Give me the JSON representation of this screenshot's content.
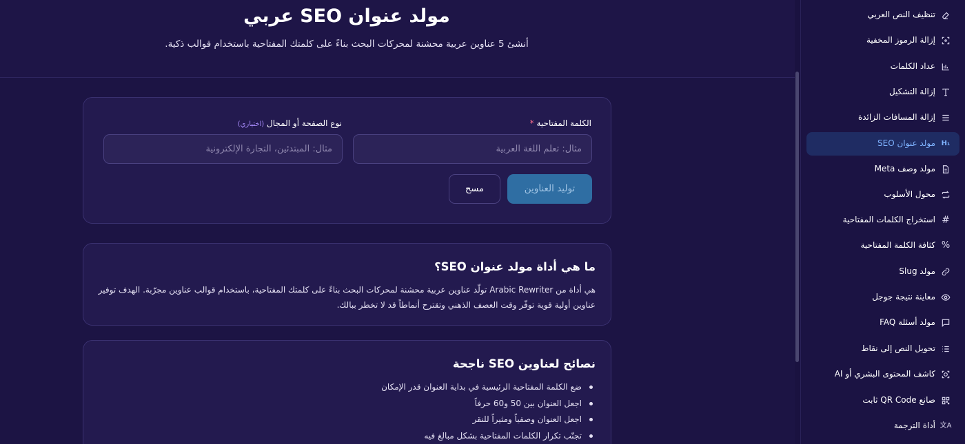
{
  "header": {
    "title": "مولد عنوان SEO عربي",
    "subtitle": "أنشئ 5 عناوين عربية محشنة لمحركات البحث بناءً على كلمتك المفتاحية باستخدام قوالب ذكية."
  },
  "form": {
    "keyword_label": "الكلمة المفتاحية",
    "keyword_required_mark": "*",
    "keyword_placeholder": "مثال: تعلم اللغة العربية",
    "type_label": "نوع الصفحة أو المجال",
    "type_optional": "(اختياري)",
    "type_placeholder": "مثال: المبتدئين، التجارة الإلكترونية",
    "generate_label": "توليد العناوين",
    "clear_label": "مسح"
  },
  "info": {
    "title": "ما هي أداة مولد عنوان SEO؟",
    "text": "هي أداة من Arabic Rewriter تولّد عناوين عربية محشنة لمحركات البحث بناءً على كلمتك المفتاحية، باستخدام قوالب عناوين مجرّبة. الهدف توفير عناوين أولية قوية توفّر وقت العصف الذهني وتقترح أنماطاً قد لا تخطر ببالك."
  },
  "tips": {
    "title": "نصائح لعناوين SEO ناجحة",
    "items": [
      "ضع الكلمة المفتاحية الرئيسية في بداية العنوان قدر الإمكان",
      "اجعل العنوان بين 50 و60 حرفاً",
      "اجعل العنوان وصفياً ومثيراً للنقر",
      "تجنّب تكرار الكلمات المفتاحية بشكل مبالغ فيه"
    ]
  },
  "sidebar": {
    "items": [
      {
        "label": "تنظيف النص العربي",
        "icon": "eraser-icon"
      },
      {
        "label": "إزالة الرموز المخفية",
        "icon": "scan-icon"
      },
      {
        "label": "عداد الكلمات",
        "icon": "chart-icon"
      },
      {
        "label": "إزالة التشكيل",
        "icon": "type-icon"
      },
      {
        "label": "إزالة المسافات الزائدة",
        "icon": "lines-icon"
      },
      {
        "label": "مولد عنوان SEO",
        "icon": "heading-icon",
        "glyph": "H₁",
        "active": true
      },
      {
        "label": "مولد وصف Meta",
        "icon": "file-icon"
      },
      {
        "label": "محول الأسلوب",
        "icon": "repeat-icon"
      },
      {
        "label": "استخراج الكلمات المفتاحية",
        "icon": "hash-icon",
        "glyph": "#"
      },
      {
        "label": "كثافة الكلمة المفتاحية",
        "icon": "percent-icon",
        "glyph": "%"
      },
      {
        "label": "مولد Slug",
        "icon": "link-icon"
      },
      {
        "label": "معاينة نتيجة جوجل",
        "icon": "eye-icon"
      },
      {
        "label": "مولد أسئلة FAQ",
        "icon": "message-icon"
      },
      {
        "label": "تحويل النص إلى نقاط",
        "icon": "list-icon"
      },
      {
        "label": "كاشف المحتوى البشري أو AI",
        "icon": "ai-scan-icon"
      },
      {
        "label": "صانع QR Code ثابت",
        "icon": "qr-icon"
      },
      {
        "label": "أداة الترجمة",
        "icon": "translate-icon",
        "glyph": "文A"
      }
    ]
  },
  "colors": {
    "background": "#1c1444",
    "card": "#231a4f",
    "active": "#1f2c63",
    "accent_button": "#2f6ea3",
    "required": "#ff6f8f",
    "optional": "#a78bfa"
  }
}
